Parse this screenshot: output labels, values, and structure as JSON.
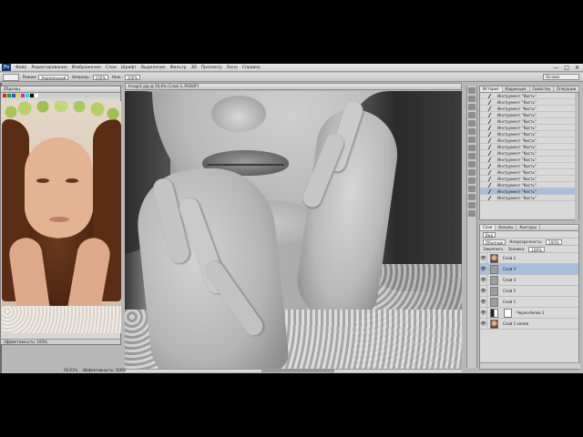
{
  "app": {
    "logo": "Ps",
    "menu": [
      "Файл",
      "Редактирование",
      "Изображение",
      "Слои",
      "Шрифт",
      "Выделение",
      "Фильтр",
      "3D",
      "Просмотр",
      "Окно",
      "Справка"
    ],
    "window_controls": [
      "—",
      "□",
      "✕"
    ]
  },
  "options_bar": {
    "mode_label": "Режим:",
    "mode_value": "Нормальный",
    "opacity_label": "Непрозр.:",
    "opacity_value": "100%",
    "flow_label": "Наж.:",
    "flow_value": "100%",
    "workspace": "Основн."
  },
  "reference_window": {
    "title": "Образец",
    "status": "Эффективность: 100%"
  },
  "document": {
    "tab_title": "Image1.jpg @ 50,6% (Слой 3, RGB/8*)",
    "status_zoom": "50,61%",
    "status_info": "Эффективность: 100%"
  },
  "history_panel": {
    "tabs": [
      "История",
      "Коррекция",
      "Свойства",
      "Операции"
    ],
    "item_label": "Инструмент \"Кисть\"",
    "item_count": 17,
    "selected_index": 15
  },
  "layers_panel": {
    "tabs": [
      "Слои",
      "Каналы",
      "Контуры"
    ],
    "kind_label": "Вид",
    "blend_mode": "Обычные",
    "opacity_label": "Непрозрачность:",
    "opacity_value": "100%",
    "lock_label": "Закрепить:",
    "fill_label": "Заливка:",
    "fill_value": "100%",
    "layers": [
      {
        "name": "Слой 2",
        "thumb": "portrait",
        "selected": false
      },
      {
        "name": "Слой 3",
        "thumb": "gray",
        "selected": true
      },
      {
        "name": "Слой 4",
        "thumb": "gray",
        "selected": false
      },
      {
        "name": "Слой 5",
        "thumb": "gray",
        "selected": false
      },
      {
        "name": "Слой 1",
        "thumb": "gray",
        "selected": false
      },
      {
        "name": "Черно-белое 1",
        "thumb": "adj",
        "selected": false
      },
      {
        "name": "Слой 1 копия",
        "thumb": "portrait",
        "selected": false
      }
    ]
  },
  "colors": {
    "selection": "#a9bfe0",
    "panel_bg": "#d9d9d9",
    "app_bg": "#b8b8b8"
  }
}
